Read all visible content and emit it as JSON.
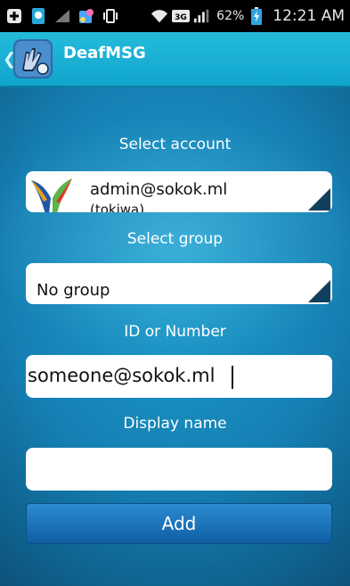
{
  "status_bar": {
    "battery_percent": "62%",
    "time": "12:21 AM",
    "network_label": "3G",
    "icons": [
      "add-icon",
      "app-notification-icon",
      "signal-muted-icon",
      "puzzle-icon",
      "vibrate-icon",
      "wifi-icon",
      "3g-icon",
      "cell-signal-icon",
      "battery-charging-icon"
    ]
  },
  "action_bar": {
    "title": "DeafMSG",
    "up_glyph": "❮"
  },
  "form": {
    "select_account_label": "Select account",
    "account_value": "admin@sokok.ml",
    "account_subvalue": "(tokiwa)",
    "select_group_label": "Select group",
    "group_value": "No group",
    "id_label": "ID or Number",
    "id_value": "someone@sokok.ml",
    "display_name_label": "Display name",
    "display_name_value": "",
    "add_button": "Add"
  },
  "colors": {
    "action_bar": "#1ab0d6",
    "background": "#157fb2",
    "button": "#1b73ba",
    "spinner_corner": "#10405e"
  }
}
